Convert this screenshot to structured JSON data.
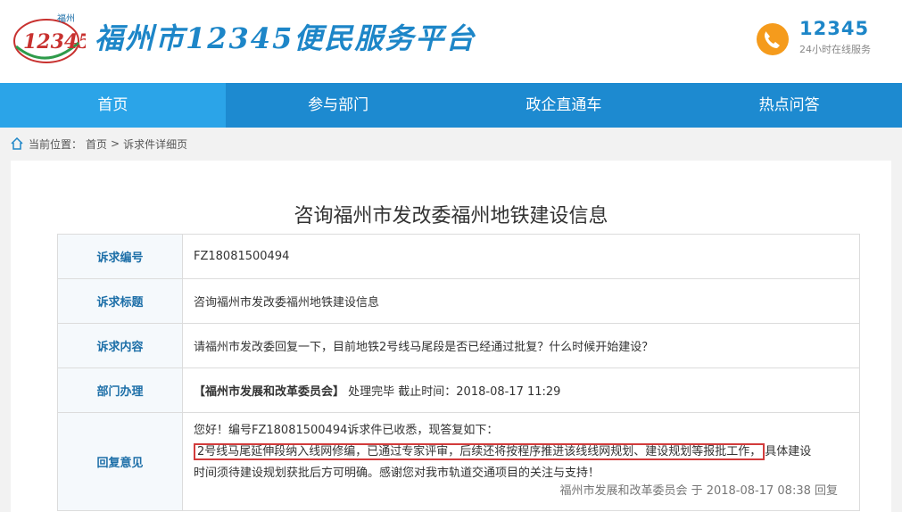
{
  "header": {
    "logo_city": "福州",
    "logo_number": "12345",
    "title": "福州市12345便民服务平台",
    "hotline_number": "12345",
    "hotline_sub": "24小时在线服务"
  },
  "nav": {
    "items": [
      {
        "label": "首页",
        "active": true
      },
      {
        "label": "参与部门"
      },
      {
        "label": "政企直通车"
      },
      {
        "label": "热点问答"
      }
    ]
  },
  "breadcrumb": {
    "prefix": "当前位置：",
    "home": "首页",
    "sep": ">",
    "current": "诉求件详细页"
  },
  "page_title": "咨询福州市发改委福州地铁建设信息",
  "detail": {
    "rows": [
      {
        "label": "诉求编号",
        "value": "FZ18081500494"
      },
      {
        "label": "诉求标题",
        "value": "咨询福州市发改委福州地铁建设信息"
      },
      {
        "label": "诉求内容",
        "value": "请福州市发改委回复一下，目前地铁2号线马尾段是否已经通过批复？什么时候开始建设？"
      },
      {
        "label": "部门办理",
        "dept": "【福州市发展和改革委员会】",
        "status": "处理完毕 截止时间：2018-08-17 11:29"
      },
      {
        "label": "回复意见"
      }
    ],
    "reply": {
      "line1": "您好！编号FZ18081500494诉求件已收悉，现答复如下：",
      "highlight": "2号线马尾延伸段纳入线网修编，已通过专家评审，后续还将按程序推进该线线网规划、建设规划等报批工作，",
      "rest1": "具体建设",
      "line3": "时间须待建设规划获批后方可明确。感谢您对我市轨道交通项目的关注与支持！",
      "footer": "福州市发展和改革委员会 于 2018-08-17 08:38 回复"
    }
  }
}
